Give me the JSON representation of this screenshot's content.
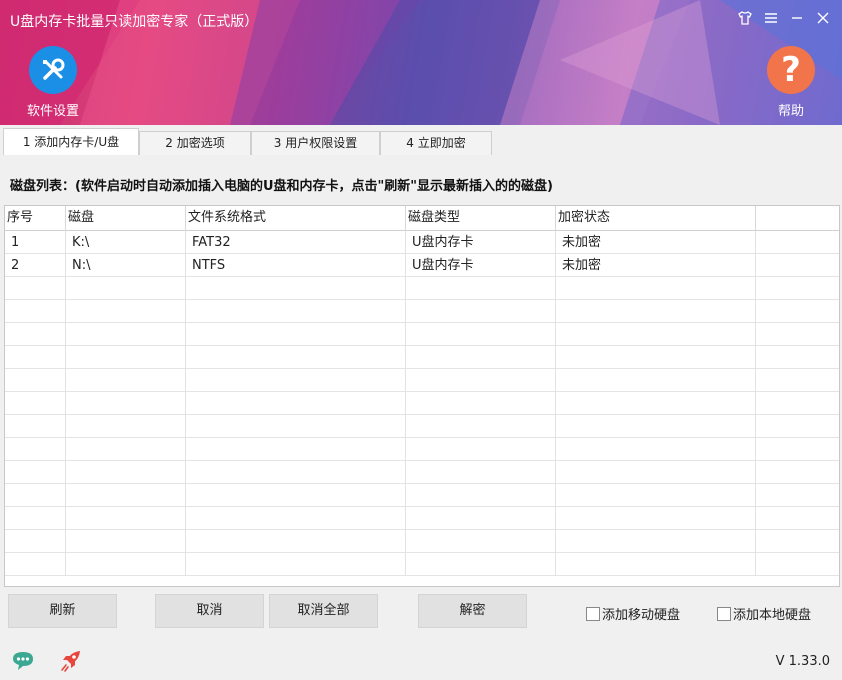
{
  "window": {
    "title": "U盘内存卡批量只读加密专家（正式版）"
  },
  "header": {
    "settings_label": "软件设置",
    "help_label": "帮助",
    "help_glyph": "?"
  },
  "tabs": [
    {
      "label": "1 添加内存卡/U盘",
      "active": true
    },
    {
      "label": "2 加密选项",
      "active": false
    },
    {
      "label": "3 用户权限设置",
      "active": false
    },
    {
      "label": "4 立即加密",
      "active": false
    }
  ],
  "disk_list": {
    "caption": "磁盘列表：(软件启动时自动添加插入电脑的U盘和内存卡，点击\"刷新\"显示最新插入的的磁盘)",
    "columns": [
      "序号",
      "磁盘",
      "文件系统格式",
      "磁盘类型",
      "加密状态"
    ],
    "rows": [
      [
        "1",
        "K:\\",
        "FAT32",
        "U盘内存卡",
        "未加密"
      ],
      [
        "2",
        "N:\\",
        "NTFS",
        "U盘内存卡",
        "未加密"
      ]
    ]
  },
  "actions": {
    "refresh": "刷新",
    "cancel": "取消",
    "cancel_all": "取消全部",
    "decrypt": "解密"
  },
  "options": {
    "add_removable_hdd": "添加移动硬盘",
    "add_local_hdd": "添加本地硬盘",
    "add_removable_hdd_checked": false,
    "add_local_hdd_checked": false
  },
  "footer": {
    "version": "V 1.33.0"
  },
  "colors": {
    "settings_circle": "#1b8fe6",
    "help_circle": "#f2744a",
    "chat_icon": "#3aa893",
    "rocket_icon": "#e8453c"
  }
}
